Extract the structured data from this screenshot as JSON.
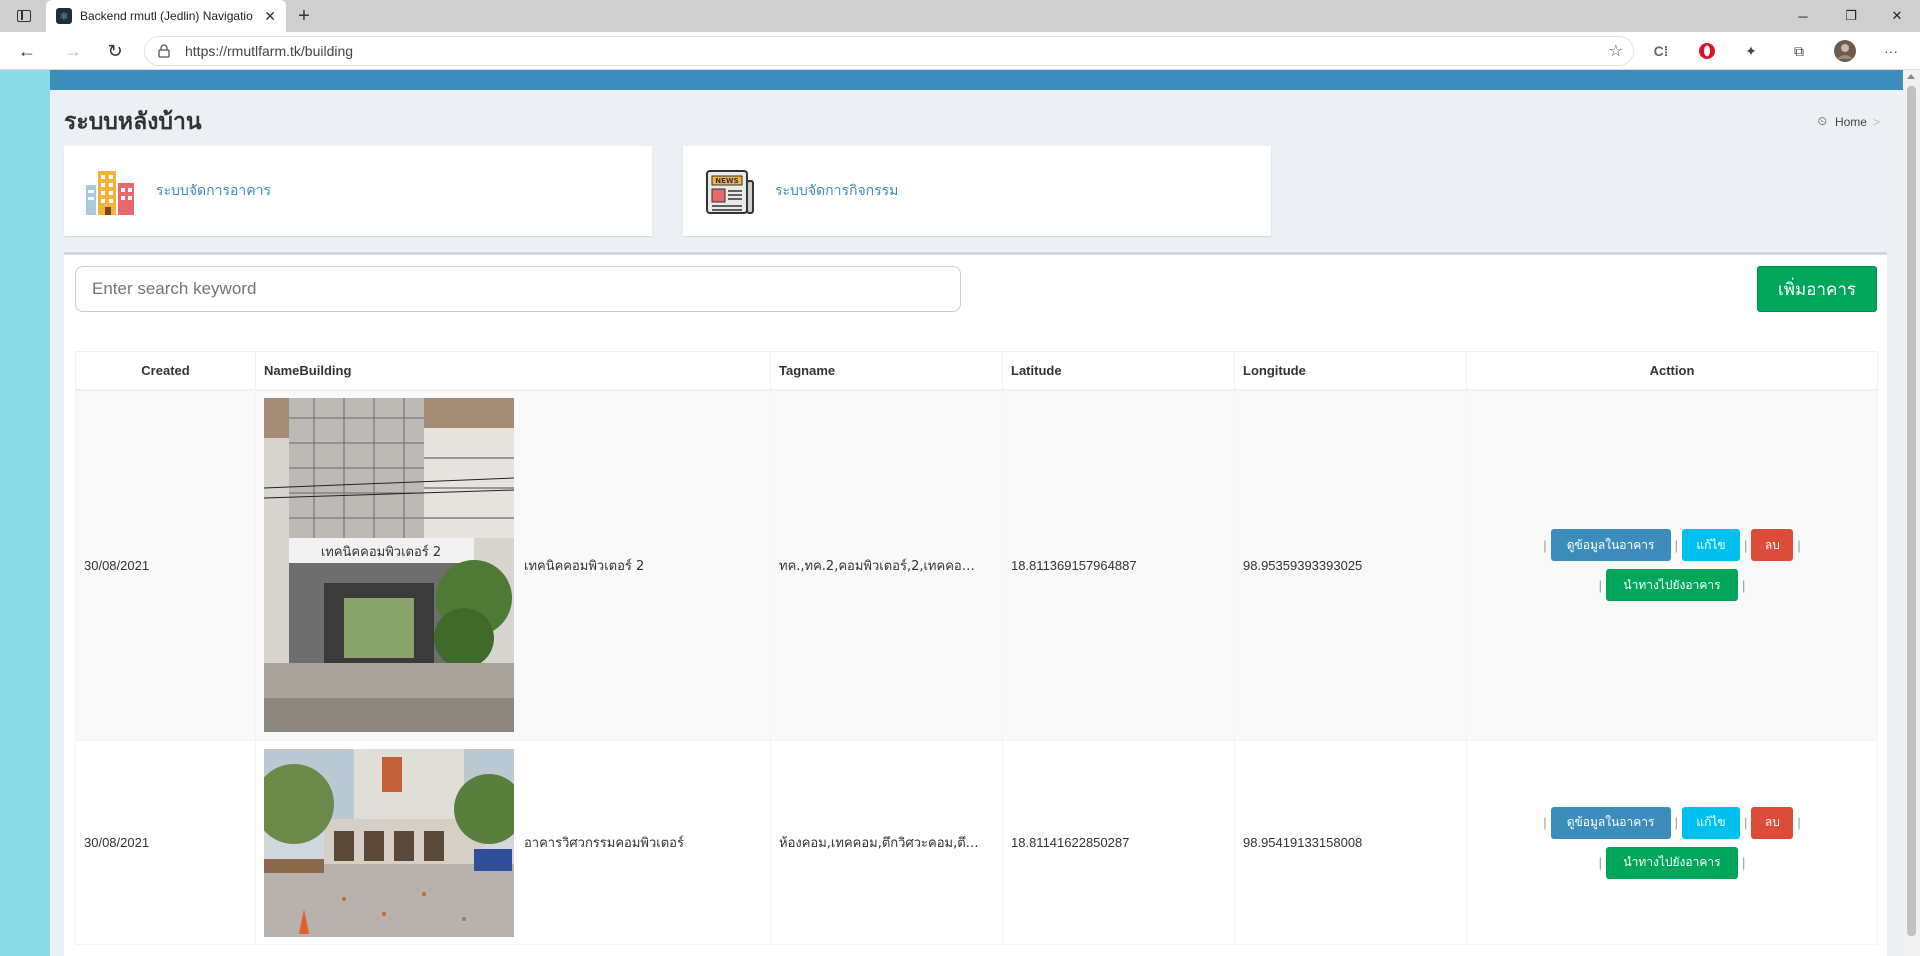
{
  "browser": {
    "tab_title": "Backend rmutl (Jedlin) Navigatio",
    "url": "https://rmutlfarm.tk/building",
    "new_tab_symbol": "+",
    "close_symbol": "✕"
  },
  "page": {
    "title": "ระบบหลังบ้าน",
    "breadcrumb": {
      "home": "Home",
      "separator": ">"
    },
    "colors": {
      "primary": "#3c8dbc",
      "success": "#00a65a",
      "info": "#00c0ef",
      "danger": "#dd4b39",
      "sidebar": "#8adde8"
    }
  },
  "cards": [
    {
      "label": "ระบบจัดการอาคาร",
      "icon": "buildings-icon"
    },
    {
      "label": "ระบบจัดการกิจกรรม",
      "icon": "newspaper-icon"
    }
  ],
  "toolbar": {
    "search_placeholder": "Enter search keyword",
    "add_label": "เพิ่มอาคาร"
  },
  "table": {
    "headers": {
      "created": "Created",
      "name": "NameBuilding",
      "tag": "Tagname",
      "lat": "Latitude",
      "lng": "Longitude",
      "action": "Acttion"
    },
    "rows": [
      {
        "created": "30/08/2021",
        "name": "เทคนิคคอมพิวเตอร์ 2",
        "tag": "ทค.,ทค.2,คอมพิวเตอร์,2,เทคคอม,ค...",
        "lat": "18.811369157964887",
        "lng": "98.95359393393025"
      },
      {
        "created": "30/08/2021",
        "name": "อาคารวิศวกรรมคอมพิวเตอร์",
        "tag": "ห้องคอม,เทคคอม,ตึกวิศวะคอม,ตึกวิ...",
        "lat": "18.81141622850287",
        "lng": "98.95419133158008"
      }
    ],
    "actions": {
      "view": "ดูข้อมูลในอาคาร",
      "edit": "แก้ไข",
      "delete": "ลบ",
      "navigate": "นำทางไปยังอาคาร",
      "pipe": "|"
    }
  }
}
